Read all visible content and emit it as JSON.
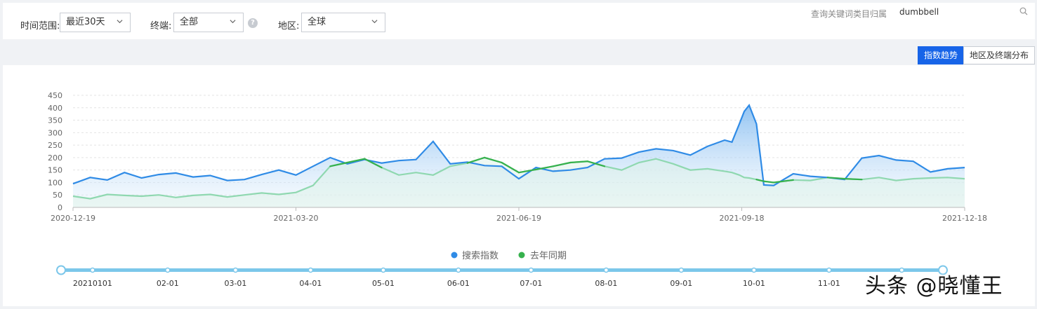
{
  "filters": {
    "time_label": "时间范围:",
    "time_value": "最近30天",
    "device_label": "终端:",
    "device_value": "全部",
    "help_glyph": "?",
    "region_label": "地区:",
    "region_value": "全球"
  },
  "search": {
    "label": "查询关键词类目归属",
    "value": "dumbbell"
  },
  "tabs": [
    {
      "label": "指数趋势",
      "active": true
    },
    {
      "label": "地区及终端分布",
      "active": false
    }
  ],
  "colors": {
    "accent": "#1764e8",
    "series_current": "#2f8be6",
    "series_last_year": "#36b14d",
    "last_year_line": "#8fd8b0",
    "slider": "#7cc7ea"
  },
  "chart_data": {
    "type": "area",
    "x_range": [
      "2020-12-19",
      "2021-12-18"
    ],
    "x_tick_labels": [
      "2020-12-19",
      "2021-03-20",
      "2021-06-19",
      "2021-09-18",
      "2021-12-18"
    ],
    "ylim": [
      0,
      450
    ],
    "y_ticks": [
      0,
      50,
      100,
      150,
      200,
      250,
      300,
      350,
      400,
      450
    ],
    "grid": true,
    "legend": "bottom-center",
    "series": [
      {
        "name": "搜索指数",
        "points": [
          [
            "2020-12-19",
            95
          ],
          [
            "2020-12-26",
            120
          ],
          [
            "2021-01-02",
            110
          ],
          [
            "2021-01-09",
            140
          ],
          [
            "2021-01-16",
            118
          ],
          [
            "2021-01-23",
            132
          ],
          [
            "2021-01-30",
            138
          ],
          [
            "2021-02-06",
            122
          ],
          [
            "2021-02-13",
            128
          ],
          [
            "2021-02-20",
            108
          ],
          [
            "2021-02-27",
            112
          ],
          [
            "2021-03-06",
            132
          ],
          [
            "2021-03-13",
            150
          ],
          [
            "2021-03-20",
            130
          ],
          [
            "2021-03-27",
            165
          ],
          [
            "2021-04-03",
            200
          ],
          [
            "2021-04-10",
            175
          ],
          [
            "2021-04-17",
            192
          ],
          [
            "2021-04-24",
            178
          ],
          [
            "2021-05-01",
            188
          ],
          [
            "2021-05-08",
            192
          ],
          [
            "2021-05-15",
            265
          ],
          [
            "2021-05-22",
            175
          ],
          [
            "2021-05-29",
            182
          ],
          [
            "2021-06-05",
            168
          ],
          [
            "2021-06-12",
            165
          ],
          [
            "2021-06-19",
            115
          ],
          [
            "2021-06-26",
            160
          ],
          [
            "2021-07-03",
            145
          ],
          [
            "2021-07-10",
            150
          ],
          [
            "2021-07-17",
            160
          ],
          [
            "2021-07-24",
            195
          ],
          [
            "2021-07-31",
            198
          ],
          [
            "2021-08-07",
            222
          ],
          [
            "2021-08-14",
            235
          ],
          [
            "2021-08-21",
            228
          ],
          [
            "2021-08-28",
            210
          ],
          [
            "2021-09-04",
            245
          ],
          [
            "2021-09-11",
            270
          ],
          [
            "2021-09-14",
            262
          ],
          [
            "2021-09-17",
            335
          ],
          [
            "2021-09-19",
            385
          ],
          [
            "2021-09-21",
            410
          ],
          [
            "2021-09-24",
            335
          ],
          [
            "2021-09-27",
            90
          ],
          [
            "2021-10-01",
            88
          ],
          [
            "2021-10-09",
            135
          ],
          [
            "2021-10-16",
            125
          ],
          [
            "2021-10-23",
            120
          ],
          [
            "2021-10-30",
            112
          ],
          [
            "2021-11-06",
            198
          ],
          [
            "2021-11-13",
            208
          ],
          [
            "2021-11-20",
            190
          ],
          [
            "2021-11-27",
            185
          ],
          [
            "2021-12-04",
            142
          ],
          [
            "2021-12-11",
            155
          ],
          [
            "2021-12-18",
            160
          ]
        ]
      },
      {
        "name": "去年同期",
        "points": [
          [
            "2020-12-19",
            45
          ],
          [
            "2020-12-26",
            35
          ],
          [
            "2021-01-02",
            52
          ],
          [
            "2021-01-09",
            48
          ],
          [
            "2021-01-16",
            45
          ],
          [
            "2021-01-23",
            50
          ],
          [
            "2021-01-30",
            40
          ],
          [
            "2021-02-06",
            48
          ],
          [
            "2021-02-13",
            52
          ],
          [
            "2021-02-20",
            42
          ],
          [
            "2021-02-27",
            50
          ],
          [
            "2021-03-06",
            58
          ],
          [
            "2021-03-13",
            52
          ],
          [
            "2021-03-20",
            60
          ],
          [
            "2021-03-27",
            88
          ],
          [
            "2021-04-03",
            165
          ],
          [
            "2021-04-10",
            180
          ],
          [
            "2021-04-17",
            195
          ],
          [
            "2021-04-24",
            160
          ],
          [
            "2021-05-01",
            130
          ],
          [
            "2021-05-08",
            140
          ],
          [
            "2021-05-15",
            130
          ],
          [
            "2021-05-22",
            165
          ],
          [
            "2021-05-29",
            178
          ],
          [
            "2021-06-05",
            200
          ],
          [
            "2021-06-12",
            180
          ],
          [
            "2021-06-19",
            140
          ],
          [
            "2021-06-26",
            152
          ],
          [
            "2021-07-03",
            165
          ],
          [
            "2021-07-10",
            180
          ],
          [
            "2021-07-17",
            185
          ],
          [
            "2021-07-24",
            165
          ],
          [
            "2021-07-31",
            150
          ],
          [
            "2021-08-07",
            180
          ],
          [
            "2021-08-14",
            195
          ],
          [
            "2021-08-21",
            175
          ],
          [
            "2021-08-28",
            150
          ],
          [
            "2021-09-04",
            155
          ],
          [
            "2021-09-11",
            145
          ],
          [
            "2021-09-14",
            140
          ],
          [
            "2021-09-17",
            130
          ],
          [
            "2021-09-19",
            120
          ],
          [
            "2021-09-21",
            118
          ],
          [
            "2021-09-24",
            112
          ],
          [
            "2021-09-27",
            105
          ],
          [
            "2021-10-01",
            100
          ],
          [
            "2021-10-09",
            110
          ],
          [
            "2021-10-16",
            108
          ],
          [
            "2021-10-23",
            120
          ],
          [
            "2021-10-30",
            115
          ],
          [
            "2021-11-06",
            112
          ],
          [
            "2021-11-13",
            120
          ],
          [
            "2021-11-20",
            108
          ],
          [
            "2021-11-27",
            115
          ],
          [
            "2021-12-04",
            118
          ],
          [
            "2021-12-11",
            120
          ],
          [
            "2021-12-18",
            115
          ]
        ]
      }
    ],
    "range_slider": {
      "labels": [
        "20210101",
        "02-01",
        "03-01",
        "04-01",
        "05-01",
        "06-01",
        "07-01",
        "08-01",
        "09-01",
        "10-01",
        "11-01"
      ]
    }
  },
  "watermark": "头条 @晓懂王"
}
